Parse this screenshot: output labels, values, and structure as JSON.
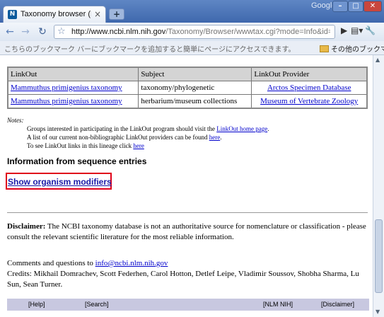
{
  "browser": {
    "tab_title": "Taxonomy browser (Mamm…",
    "tab_close": "×",
    "new_tab": "+",
    "brand": "Google",
    "url_host": "http://www.ncbi.nlm.nih.gov",
    "url_path": "/Taxonomy/Browser/wwwtax.cgi?mode=Info&id=",
    "bookmarks_hint": "こちらのブックマーク バーにブックマークを追加すると簡単にページにアクセスできます。",
    "other_bookmarks": "その他のブックマーク"
  },
  "linkout_table": {
    "headers": [
      "LinkOut",
      "Subject",
      "LinkOut Provider"
    ],
    "rows": [
      {
        "link": "Mammuthus primigenius taxonomy",
        "subject": "taxonomy/phylogenetic",
        "provider": "Arctos Specimen Database"
      },
      {
        "link": "Mammuthus primigenius taxonomy",
        "subject": "herbarium/museum collections",
        "provider": "Museum of Vertebrate Zoology"
      }
    ]
  },
  "notes": {
    "title": "Notes:",
    "line1_text": "Groups interested in participating in the LinkOut program should visit the ",
    "line1_link": "LinkOut home page",
    "line1_end": ".",
    "line2_text": "A list of our current non-bibliographic LinkOut providers can be found ",
    "line2_link": "here",
    "line2_end": ".",
    "line3_text": "To see LinkOut links in this lineage click ",
    "line3_link": "here"
  },
  "sequence": {
    "heading": "Information from sequence entries",
    "modifiers_link": "Show organism modifiers"
  },
  "disclaimer": {
    "label": "Disclaimer:",
    "text": " The NCBI taxonomy database is not an authoritative source for nomenclature or classification - please consult the relevant scientific literature for the most reliable information."
  },
  "comments": {
    "prefix": "Comments and questions to ",
    "email": "info@ncbi.nlm.nih.gov",
    "credits": "Credits: Mikhail Domrachev, Scott Federhen, Carol Hotton, Detlef Leipe, Vladimir Soussov, Shobha Sharma, Lu Sun, Sean Turner."
  },
  "footer": {
    "help": "[Help]",
    "search": "[Search]",
    "nlm": "[NLM NIH]",
    "disclaimer": "[Disclaimer]"
  }
}
